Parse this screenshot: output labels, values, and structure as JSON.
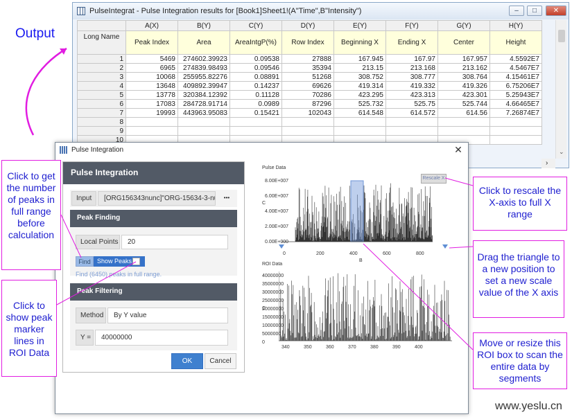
{
  "workbook": {
    "title": "PulseIntegrat - Pulse Integration results for [Book1]Sheet1!(A\"Time\",B\"Intensity\")",
    "columns": [
      "A(X)",
      "B(Y)",
      "C(Y)",
      "D(Y)",
      "E(Y)",
      "F(Y)",
      "G(Y)",
      "H(Y)"
    ],
    "long_name_label": "Long Name",
    "long_names": [
      "Peak Index",
      "Area",
      "AreaIntgP(%)",
      "Row Index",
      "Beginning X",
      "Ending X",
      "Center",
      "Height"
    ],
    "rows": [
      [
        "1",
        "5469",
        "274602.39923",
        "0.09538",
        "27888",
        "167.945",
        "167.97",
        "167.957",
        "4.5592E7"
      ],
      [
        "2",
        "6965",
        "274839.98493",
        "0.09546",
        "35394",
        "213.15",
        "213.168",
        "213.162",
        "4.5467E7"
      ],
      [
        "3",
        "10068",
        "255955.82276",
        "0.08891",
        "51268",
        "308.752",
        "308.777",
        "308.764",
        "4.15461E7"
      ],
      [
        "4",
        "13648",
        "409892.39947",
        "0.14237",
        "69626",
        "419.314",
        "419.332",
        "419.326",
        "6.75206E7"
      ],
      [
        "5",
        "13778",
        "320384.12392",
        "0.11128",
        "70286",
        "423.295",
        "423.313",
        "423.301",
        "5.25943E7"
      ],
      [
        "6",
        "17083",
        "284728.91714",
        "0.0989",
        "87296",
        "525.732",
        "525.75",
        "525.744",
        "4.66465E7"
      ],
      [
        "7",
        "19993",
        "443963.95083",
        "0.15421",
        "102043",
        "614.548",
        "614.572",
        "614.56",
        "7.26874E7"
      ]
    ],
    "empty_rows": [
      "8",
      "9",
      "10"
    ],
    "buttons": {
      "minimize": "–",
      "maximize": "□",
      "close": "✕"
    }
  },
  "annotations": {
    "output": "Output",
    "find_callout": "Click to get the number of peaks in full range before calculation",
    "show_peaks_callout": "Click to show peak marker lines in ROI Data",
    "rescale_callout": "Click to rescale the X-axis to full X range",
    "triangle_callout": "Drag the triangle to a new position to set a new scale value of the X axis",
    "roi_callout": "Move or resize this ROI box to scan the entire data by segments",
    "watermark": "www.yeslu.cn"
  },
  "dialog": {
    "title": "Pulse Integration",
    "close": "✕",
    "header": "Pulse Integration",
    "input_label": "Input",
    "input_value": "[ORG156343nunc]\"ORG-15634-3-nur",
    "input_browse": "•••",
    "peak_finding": "Peak Finding",
    "local_points_label": "Local Points",
    "local_points_value": "20",
    "find_button": "Find",
    "show_peaks": "Show Peaks",
    "find_note": "Find (6450) peaks in full range.",
    "peak_filtering": "Peak Filtering",
    "method_label": "Method",
    "method_value": "By Y value",
    "y_label": "Y =",
    "y_value": "40000000",
    "ok": "OK",
    "cancel": "Cancel"
  },
  "pulse_plot": {
    "title": "Pulse Data",
    "rescale": "Rescale X",
    "ylabel": "C",
    "xlabel": "B",
    "yticks": [
      "8.00E+007",
      "6.00E+007",
      "4.00E+007",
      "2.00E+007",
      "0.00E+000"
    ],
    "xticks": [
      "0",
      "200",
      "400",
      "600",
      "800"
    ]
  },
  "roi_plot": {
    "title": "ROI Data",
    "ylabel": "C",
    "yticks": [
      "40000000",
      "35000000",
      "30000000",
      "25000000",
      "20000000",
      "15000000",
      "10000000",
      "5000000",
      "0"
    ],
    "xticks": [
      "340",
      "350",
      "360",
      "370",
      "380",
      "390",
      "400"
    ]
  },
  "colors": {
    "accent": "#3f80cf",
    "callout_border": "#e11ce1",
    "callout_text": "#2020d0",
    "header_dark": "#525a66"
  }
}
